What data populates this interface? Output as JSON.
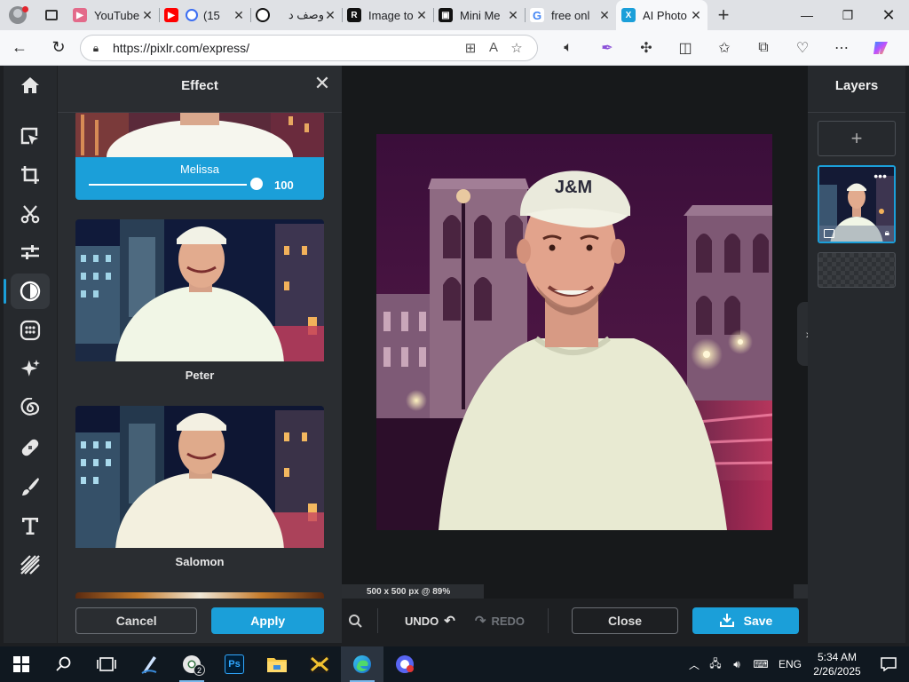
{
  "browser": {
    "tabs": [
      {
        "title": "YouTube",
        "favicon": "youtube-icon",
        "color": "#e36a8a"
      },
      {
        "title": "(15",
        "favicon": "youtube-icon",
        "color": "#ff0000"
      },
      {
        "title": "وصف د",
        "favicon": "openai-icon",
        "color": "#111111"
      },
      {
        "title": "Image to",
        "favicon": "r-icon",
        "color": "#111111"
      },
      {
        "title": "Mini Me",
        "favicon": "mini-icon",
        "color": "#111111"
      },
      {
        "title": "free onl",
        "favicon": "google-icon",
        "color": "#4285f4"
      },
      {
        "title": "AI Photo",
        "favicon": "pixlr-icon",
        "color": "#1b9fd9"
      }
    ],
    "url": "https://pixlr.com/express/"
  },
  "app": {
    "panel_title": "Effect",
    "active_effect": {
      "name": "Melissa",
      "value": "100",
      "level_fraction": 1.0
    },
    "effects": [
      {
        "name": "Peter"
      },
      {
        "name": "Salomon"
      }
    ],
    "cancel_label": "Cancel",
    "apply_label": "Apply",
    "layers_title": "Layers",
    "canvas_info": "500 x 500 px @ 89%",
    "undo_label": "UNDO",
    "redo_label": "REDO",
    "close_label": "Close",
    "save_label": "Save",
    "photo": {
      "cap_text": "J&M"
    }
  },
  "taskbar": {
    "language": "ENG",
    "time": "5:34 AM",
    "date": "2/26/2025",
    "badge_count": "2"
  },
  "colors": {
    "accent": "#1b9fd9",
    "panel": "#2a2d31",
    "rail": "#26292d",
    "canvas": "#17191b"
  }
}
